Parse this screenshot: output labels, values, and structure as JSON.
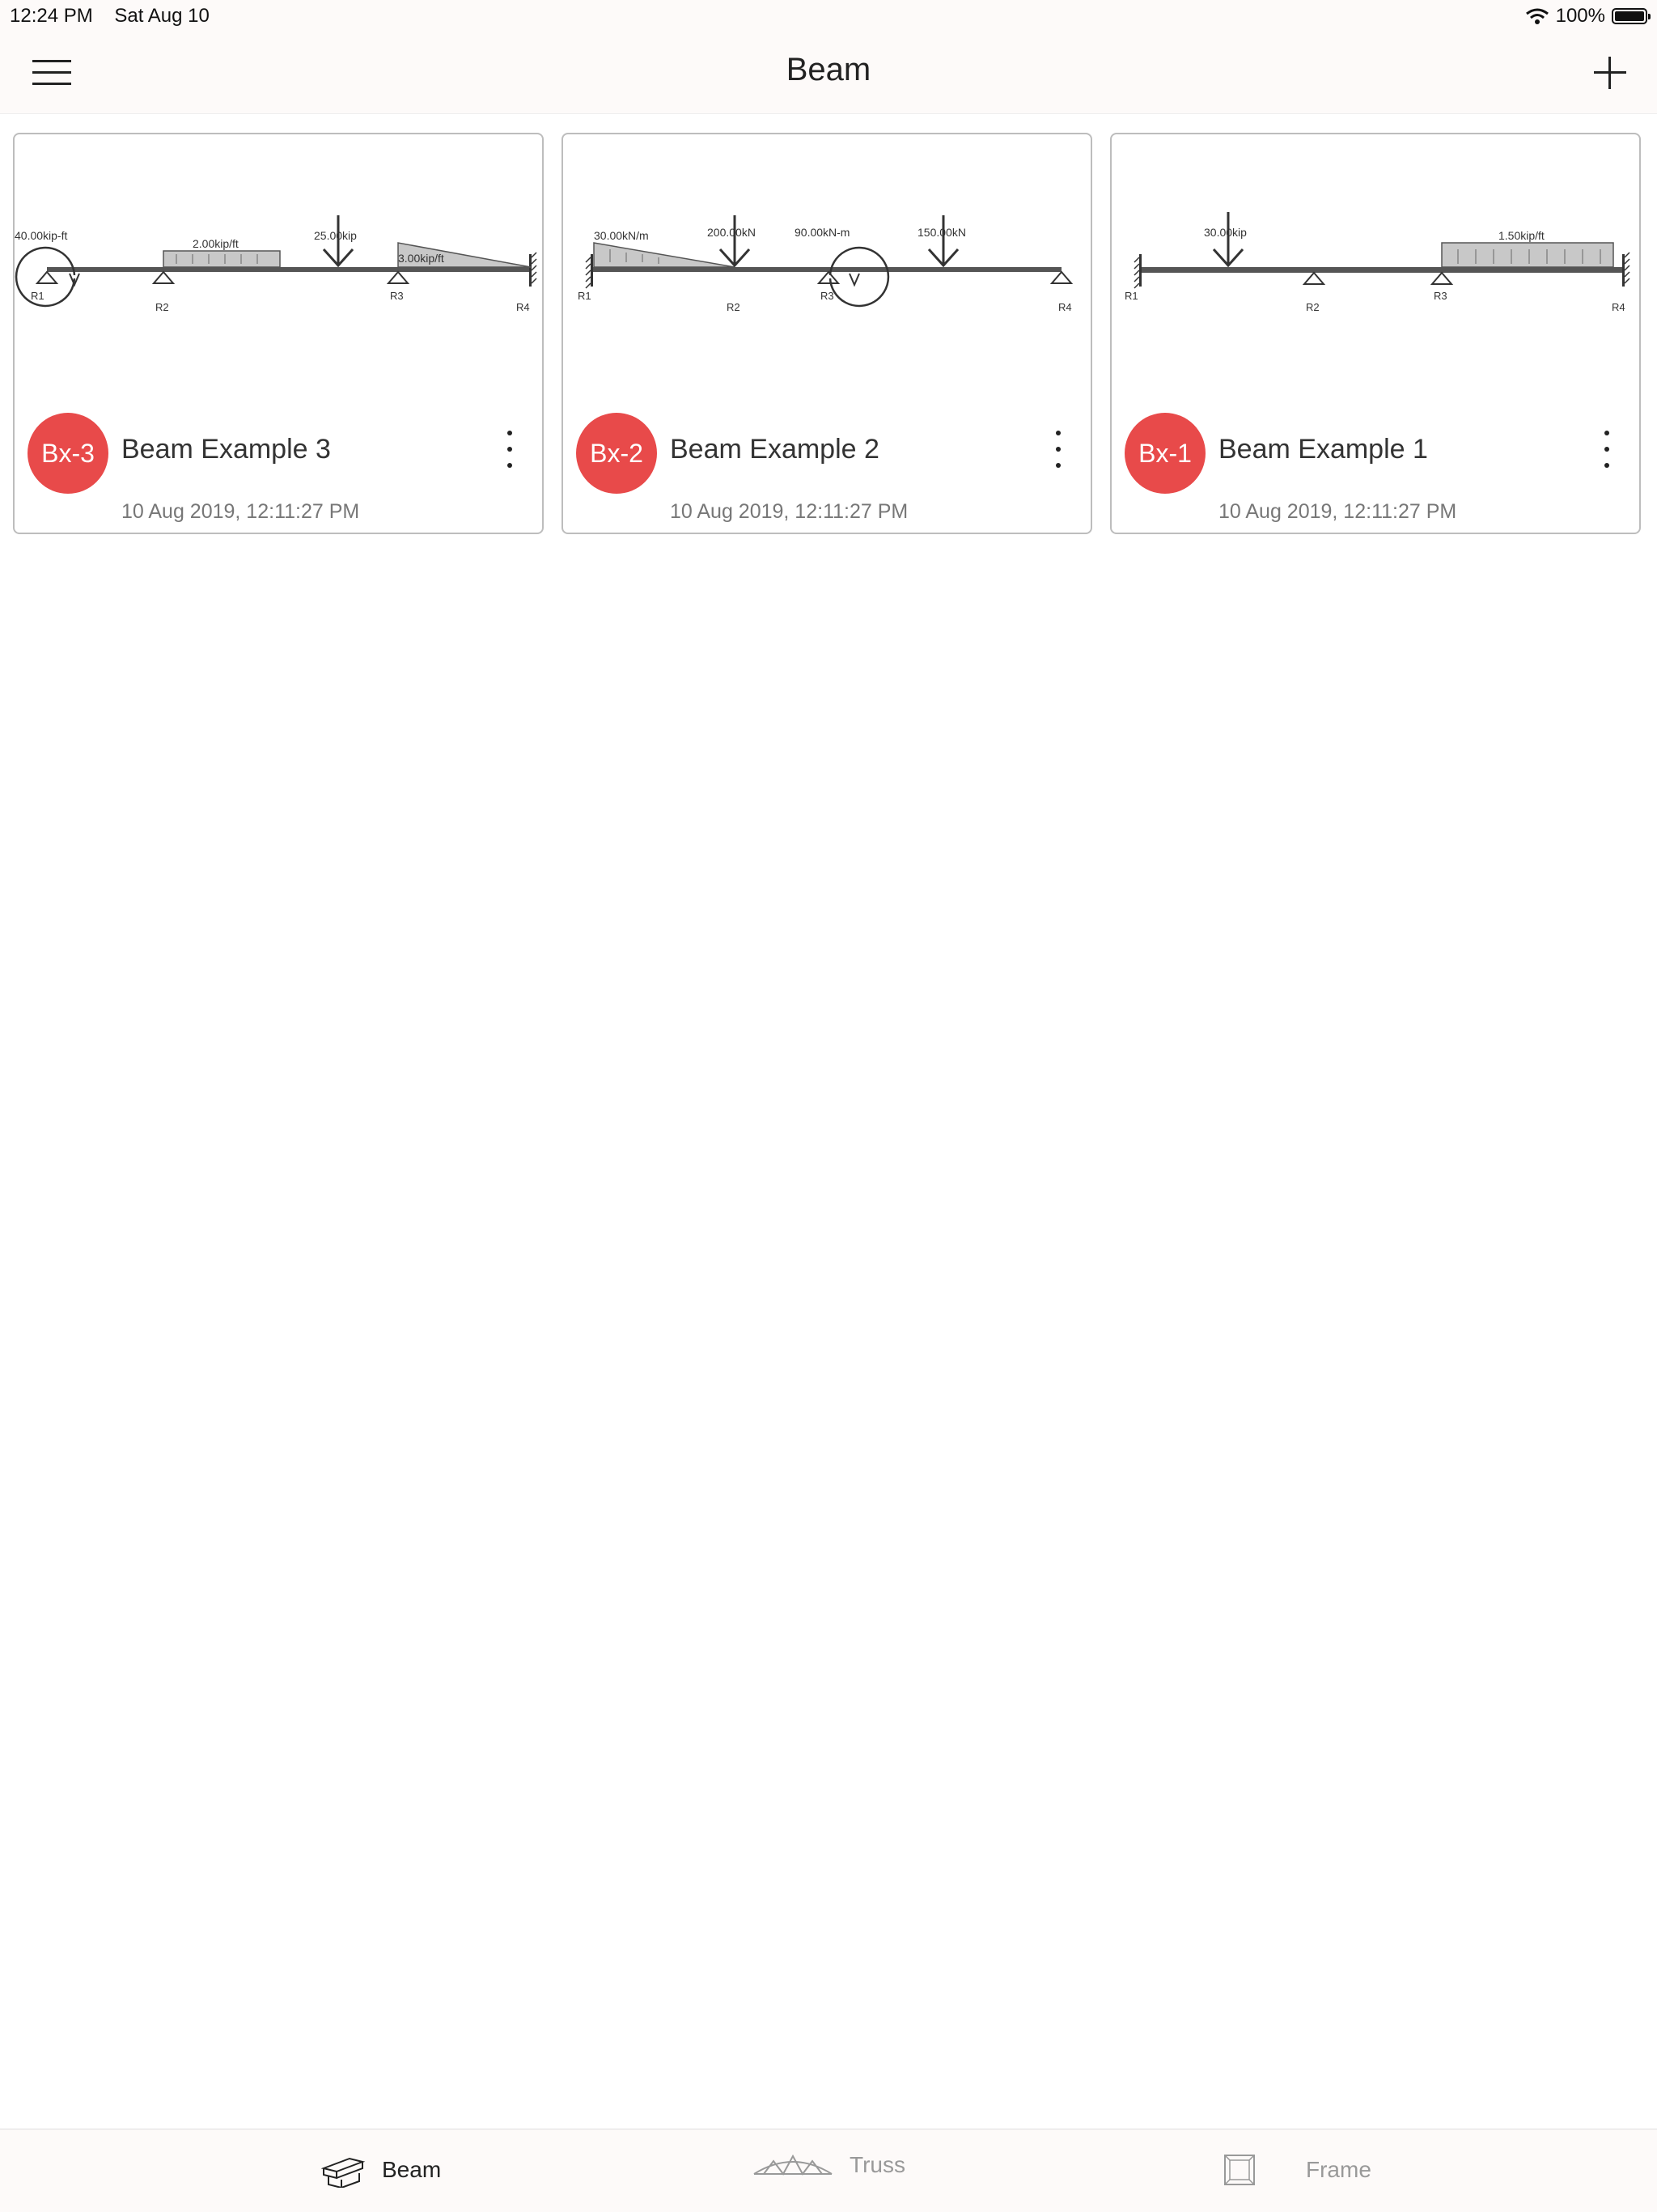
{
  "status_bar": {
    "time": "12:24 PM",
    "date": "Sat Aug 10",
    "battery": "100%"
  },
  "nav": {
    "title": "Beam"
  },
  "cards": [
    {
      "badge": "Bx-3",
      "name": "Beam Example 3",
      "date": "10 Aug 2019, 12:11:27 PM",
      "labels": {
        "moment": "40.00kip-ft",
        "udl": "2.00kip/ft",
        "point": "25.00kip",
        "tri": "3.00kip/ft",
        "r1": "R1",
        "r2": "R2",
        "r3": "R3",
        "r4": "R4"
      }
    },
    {
      "badge": "Bx-2",
      "name": "Beam Example 2",
      "date": "10 Aug 2019, 12:11:27 PM",
      "labels": {
        "tri": "30.00kN/m",
        "point1": "200.00kN",
        "moment": "90.00kN-m",
        "point2": "150.00kN",
        "r1": "R1",
        "r2": "R2",
        "r3": "R3",
        "r4": "R4"
      }
    },
    {
      "badge": "Bx-1",
      "name": "Beam Example 1",
      "date": "10 Aug 2019, 12:11:27 PM",
      "labels": {
        "point": "30.00kip",
        "udl": "1.50kip/ft",
        "r1": "R1",
        "r2": "R2",
        "r3": "R3",
        "r4": "R4"
      }
    }
  ],
  "tabs": [
    {
      "label": "Beam",
      "icon": "beam-icon",
      "active": true
    },
    {
      "label": "Truss",
      "icon": "truss-icon",
      "active": false
    },
    {
      "label": "Frame",
      "icon": "frame-icon",
      "active": false
    }
  ],
  "colors": {
    "accent": "#e84a4a",
    "background": "#fdfaf9"
  }
}
